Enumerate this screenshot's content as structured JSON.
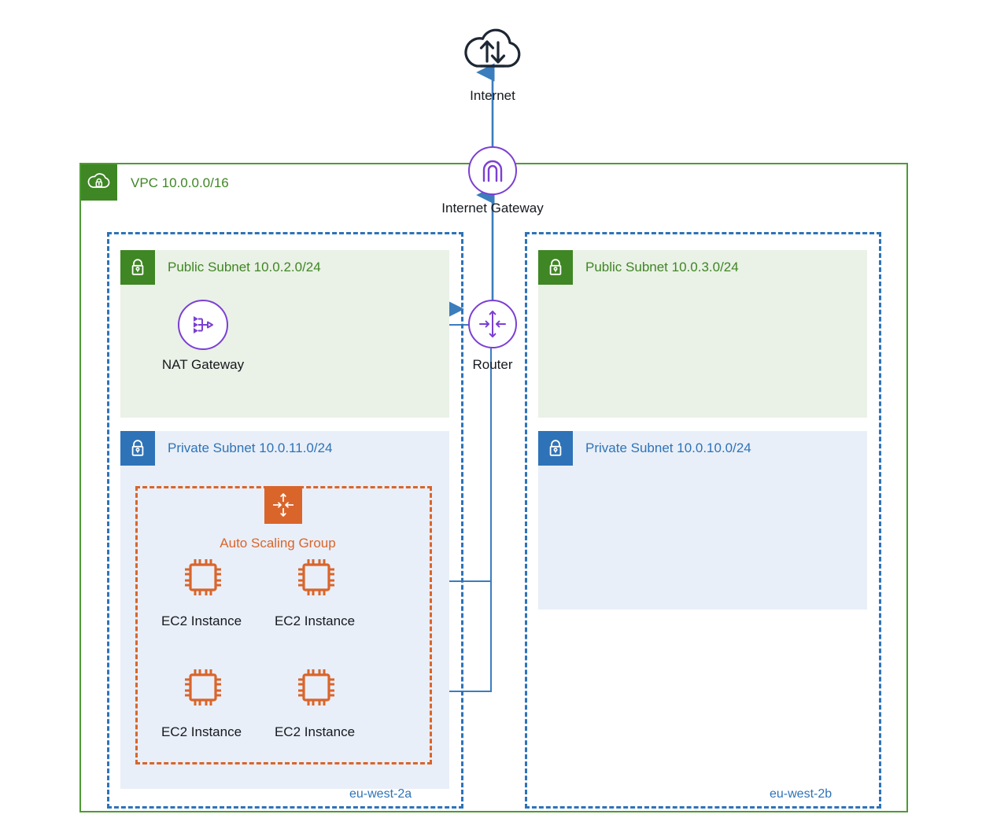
{
  "diagram": {
    "title": "AWS VPC network architecture",
    "colors": {
      "vpc_green": "#4d9b35",
      "subnet_public_green": "#3f8624",
      "subnet_private_blue": "#2e73b8",
      "az_blue": "#2e73b8",
      "asg_orange": "#d9652b",
      "node_purple": "#7b3fd4",
      "connector_blue": "#3b7dbd",
      "text_dark": "#16191f"
    }
  },
  "internet": {
    "label": "Internet",
    "icon": "internet-cloud-icon"
  },
  "internet_gateway": {
    "label": "Internet Gateway",
    "icon": "internet-gateway-icon"
  },
  "vpc": {
    "label": "VPC 10.0.0.0/16",
    "icon": "vpc-cloud-lock-icon"
  },
  "router": {
    "label": "Router",
    "icon": "router-icon"
  },
  "nat_gateway": {
    "label": "NAT Gateway",
    "icon": "nat-gateway-icon"
  },
  "availability_zones": [
    {
      "name": "eu-west-2a"
    },
    {
      "name": "eu-west-2b"
    }
  ],
  "subnets": [
    {
      "type": "public",
      "label": "Public Subnet 10.0.2.0/24",
      "zone": "eu-west-2a",
      "icon": "lock-icon"
    },
    {
      "type": "private",
      "label": "Private Subnet 10.0.11.0/24",
      "zone": "eu-west-2a",
      "icon": "lock-icon"
    },
    {
      "type": "public",
      "label": "Public Subnet 10.0.3.0/24",
      "zone": "eu-west-2b",
      "icon": "lock-icon"
    },
    {
      "type": "private",
      "label": "Private Subnet 10.0.10.0/24",
      "zone": "eu-west-2b",
      "icon": "lock-icon"
    }
  ],
  "auto_scaling_group": {
    "label": "Auto Scaling Group",
    "icon": "auto-scaling-group-icon",
    "instances": [
      {
        "label": "EC2 Instance",
        "icon": "ec2-instance-icon"
      },
      {
        "label": "EC2 Instance",
        "icon": "ec2-instance-icon"
      },
      {
        "label": "EC2 Instance",
        "icon": "ec2-instance-icon"
      },
      {
        "label": "EC2 Instance",
        "icon": "ec2-instance-icon"
      }
    ]
  },
  "connections": [
    {
      "from": "Internet",
      "to": "Internet Gateway",
      "direction": "up"
    },
    {
      "from": "Internet Gateway",
      "to": "Router",
      "direction": "up"
    },
    {
      "from": "NAT Gateway",
      "to": "Router",
      "direction": "right"
    },
    {
      "from": "Router",
      "to": "NAT Gateway",
      "direction": "left"
    },
    {
      "from": "EC2 Instances",
      "to": "Router",
      "direction": "none"
    }
  ]
}
